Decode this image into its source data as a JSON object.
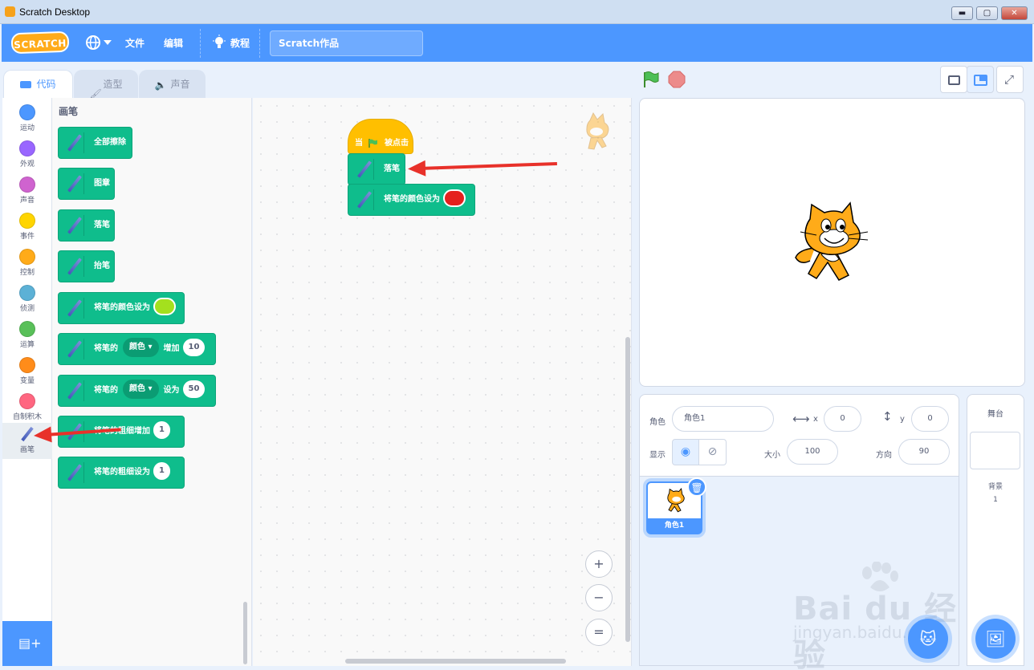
{
  "window": {
    "title": "Scratch Desktop",
    "min": "▬",
    "max": "▢",
    "close": "✕"
  },
  "menubar": {
    "logo": "SCRATCH",
    "file": "文件",
    "edit": "编辑",
    "tutorials": "教程",
    "project_title": "Scratch作品"
  },
  "tabs": {
    "code": "代码",
    "costumes": "造型",
    "sounds": "声音"
  },
  "categories": [
    {
      "label": "运动",
      "color": "#4c97ff"
    },
    {
      "label": "外观",
      "color": "#9966ff"
    },
    {
      "label": "声音",
      "color": "#cf63cf"
    },
    {
      "label": "事件",
      "color": "#ffd500"
    },
    {
      "label": "控制",
      "color": "#ffab19"
    },
    {
      "label": "侦测",
      "color": "#5cb1d6"
    },
    {
      "label": "运算",
      "color": "#59c059"
    },
    {
      "label": "变量",
      "color": "#ff8c1a"
    },
    {
      "label": "自制积木",
      "color": "#ff6680"
    },
    {
      "label": "画笔",
      "color": "#0fbd8c"
    }
  ],
  "palette": {
    "title": "画笔",
    "blocks": {
      "erase_all": "全部擦除",
      "stamp": "图章",
      "pen_down": "落笔",
      "pen_up": "抬笔",
      "set_color_to": "将笔的颜色设为",
      "change_pre": "将笔的",
      "change_dropdown": "颜色",
      "change_post": "增加",
      "change_value": "10",
      "set_pre": "将笔的",
      "set_dropdown": "颜色",
      "set_post": "设为",
      "set_value": "50",
      "change_size": "将笔的粗细增加",
      "change_size_value": "1",
      "set_size": "将笔的粗细设为",
      "set_size_value": "1"
    },
    "set_color_swatch": "#a4e01e"
  },
  "workspace": {
    "hat_when": "当",
    "hat_clicked": "被点击",
    "pen_down": "落笔",
    "set_color": "将笔的颜色设为",
    "set_color_swatch": "#e5201e",
    "zoom_in": "+",
    "zoom_out": "−",
    "zoom_reset": "="
  },
  "sprite_info": {
    "sprite_label": "角色",
    "sprite_name": "角色1",
    "x_label": "x",
    "x_value": "0",
    "y_label": "y",
    "y_value": "0",
    "show_label": "显示",
    "size_label": "大小",
    "size_value": "100",
    "direction_label": "方向",
    "direction_value": "90"
  },
  "sprite_list": [
    {
      "name": "角色1"
    }
  ],
  "stage_pane": {
    "title": "舞台",
    "backdrops_label": "背景",
    "backdrops_count": "1"
  },
  "watermark": {
    "text": "Bai du 经验",
    "url": "jingyan.baidu.com"
  }
}
